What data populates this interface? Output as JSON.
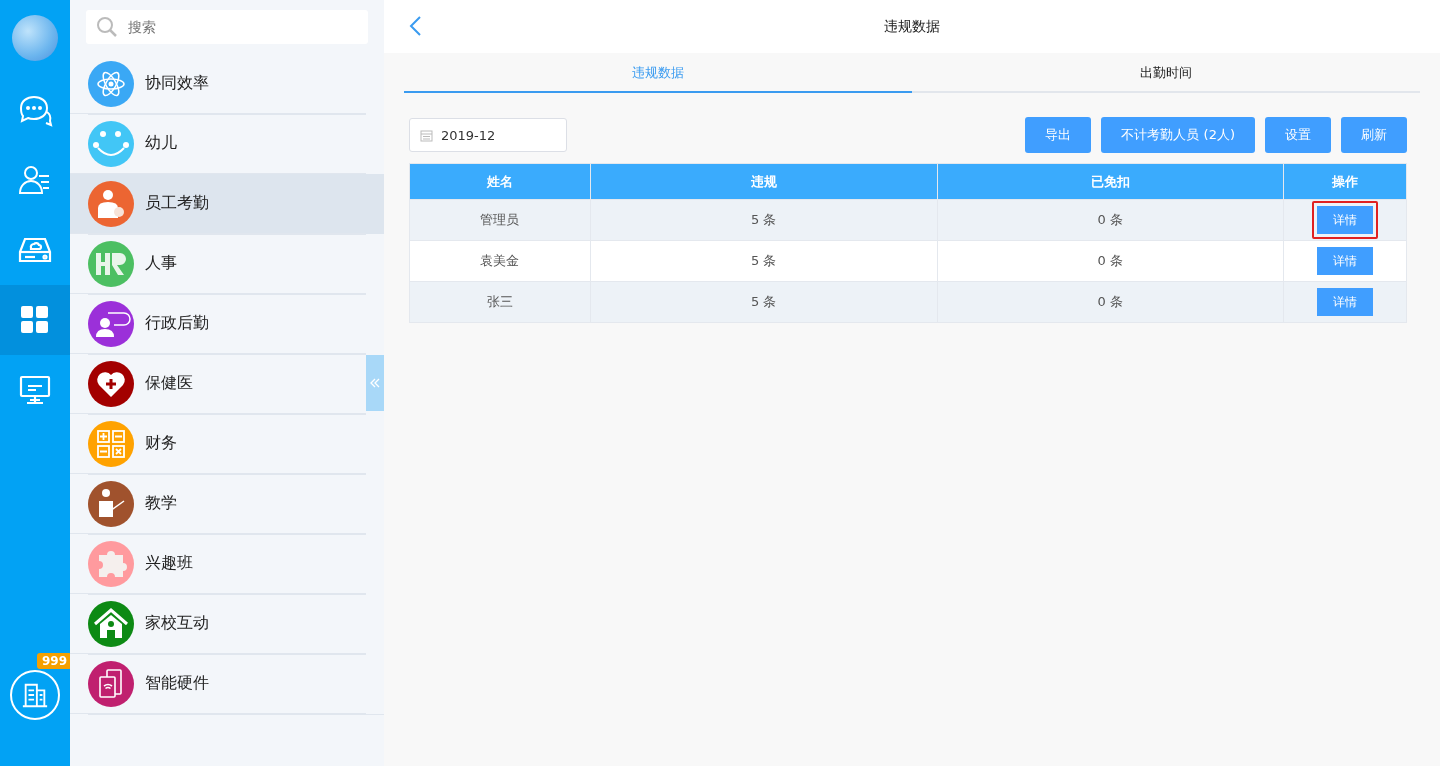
{
  "rail": {
    "items": [
      {
        "kind": "chat",
        "selected": false
      },
      {
        "kind": "contacts",
        "selected": false
      },
      {
        "kind": "drive",
        "selected": false
      },
      {
        "kind": "apps",
        "selected": true
      },
      {
        "kind": "monitor",
        "selected": false
      }
    ],
    "badge": "999"
  },
  "sidebar": {
    "search": {
      "placeholder": "搜索"
    },
    "items": [
      {
        "label": "协同效率",
        "kind": "atom",
        "color": "#3aa8f5",
        "selected": false
      },
      {
        "label": "幼儿",
        "kind": "smile",
        "color": "#42c6f6",
        "selected": false
      },
      {
        "label": "员工考勤",
        "kind": "person",
        "color": "#ec6532",
        "selected": true
      },
      {
        "label": "人事",
        "kind": "hr",
        "color": "#4cbf62",
        "selected": false
      },
      {
        "label": "行政后勤",
        "kind": "speaker",
        "color": "#9b30d9",
        "selected": false
      },
      {
        "label": "保健医",
        "kind": "heart",
        "color": "#a30000",
        "selected": false
      },
      {
        "label": "财务",
        "kind": "calc",
        "color": "#ffa200",
        "selected": false
      },
      {
        "label": "教学",
        "kind": "teacher",
        "color": "#a0522d",
        "selected": false
      },
      {
        "label": "兴趣班",
        "kind": "puzzle",
        "color": "#ff9a9e",
        "selected": false
      },
      {
        "label": "家校互动",
        "kind": "house",
        "color": "#0d8a14",
        "selected": false
      },
      {
        "label": "智能硬件",
        "kind": "device",
        "color": "#c0206f",
        "selected": false
      }
    ]
  },
  "header": {
    "title": "违规数据"
  },
  "tabs": [
    {
      "label": "违规数据",
      "selected": true
    },
    {
      "label": "出勤时间",
      "selected": false
    }
  ],
  "date_field": {
    "value": "2019-12"
  },
  "buttons": [
    "导出",
    "不计考勤人员 (2人)",
    "设置",
    "刷新"
  ],
  "table": {
    "columns": [
      "姓名",
      "违规",
      "已免扣",
      "操作"
    ],
    "rows": [
      {
        "name": "管理员",
        "violations": "5 条",
        "exempted": "0 条",
        "action": "详情",
        "highlighted": true
      },
      {
        "name": "袁美金",
        "violations": "5 条",
        "exempted": "0 条",
        "action": "详情",
        "highlighted": false
      },
      {
        "name": "张三",
        "violations": "5 条",
        "exempted": "0 条",
        "action": "详情",
        "highlighted": false
      }
    ]
  }
}
